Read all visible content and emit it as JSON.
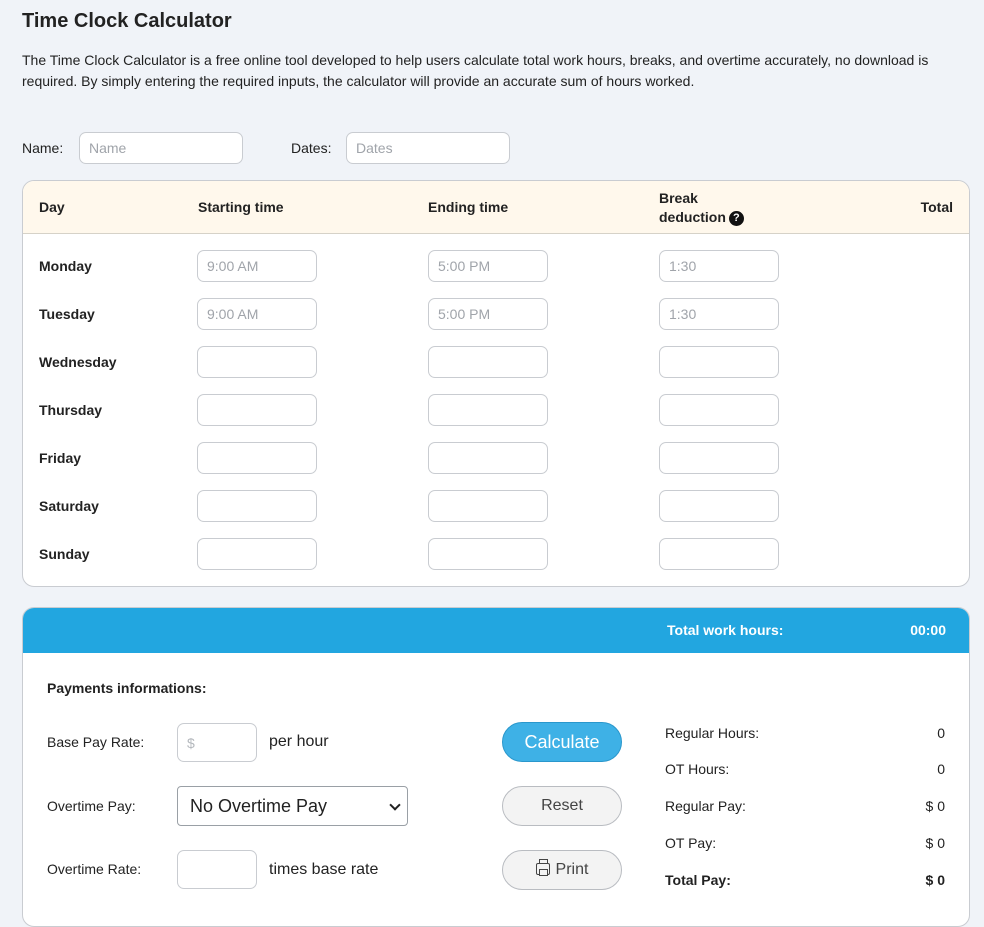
{
  "page": {
    "title": "Time Clock Calculator",
    "intro": "The Time Clock Calculator is a free online tool developed to help users calculate total work hours, breaks, and overtime accurately, no download is required. By simply entering the required inputs, the calculator will provide an accurate sum of hours worked."
  },
  "meta_fields": {
    "name_label": "Name:",
    "name_placeholder": "Name",
    "dates_label": "Dates:",
    "dates_placeholder": "Dates"
  },
  "table": {
    "headers": {
      "day": "Day",
      "start": "Starting time",
      "end": "Ending time",
      "break_line1": "Break",
      "break_line2": "deduction",
      "total": "Total"
    },
    "rows": [
      {
        "day": "Monday",
        "start_ph": "9:00 AM",
        "end_ph": "5:00 PM",
        "break_ph": "1:30",
        "total": ""
      },
      {
        "day": "Tuesday",
        "start_ph": "9:00 AM",
        "end_ph": "5:00 PM",
        "break_ph": "1:30",
        "total": ""
      },
      {
        "day": "Wednesday",
        "start_ph": "",
        "end_ph": "",
        "break_ph": "",
        "total": ""
      },
      {
        "day": "Thursday",
        "start_ph": "",
        "end_ph": "",
        "break_ph": "",
        "total": ""
      },
      {
        "day": "Friday",
        "start_ph": "",
        "end_ph": "",
        "break_ph": "",
        "total": ""
      },
      {
        "day": "Saturday",
        "start_ph": "",
        "end_ph": "",
        "break_ph": "",
        "total": ""
      },
      {
        "day": "Sunday",
        "start_ph": "",
        "end_ph": "",
        "break_ph": "",
        "total": ""
      }
    ]
  },
  "results": {
    "total_hours_label": "Total work hours:",
    "total_hours_value": "00:00"
  },
  "payments": {
    "heading": "Payments informations:",
    "base_rate_label": "Base Pay Rate:",
    "base_rate_placeholder": "$",
    "base_rate_unit": "per hour",
    "overtime_pay_label": "Overtime Pay:",
    "overtime_pay_selected": "No Overtime Pay",
    "overtime_rate_label": "Overtime Rate:",
    "overtime_rate_unit": "times base rate"
  },
  "buttons": {
    "calculate": "Calculate",
    "reset": "Reset",
    "print": "Print"
  },
  "summary": {
    "regular_hours_label": "Regular Hours:",
    "regular_hours_value": "0",
    "ot_hours_label": "OT Hours:",
    "ot_hours_value": "0",
    "regular_pay_label": "Regular Pay:",
    "regular_pay_value": "$ 0",
    "ot_pay_label": "OT Pay:",
    "ot_pay_value": "$ 0",
    "total_pay_label": "Total Pay:",
    "total_pay_value": "$ 0"
  },
  "colors": {
    "accent": "#22a6e0",
    "header_bg": "#fff8ec",
    "page_bg": "#f0f3f8"
  },
  "icons": {
    "help": "question-circle-icon",
    "print": "printer-icon",
    "select": "chevron-down-icon"
  }
}
